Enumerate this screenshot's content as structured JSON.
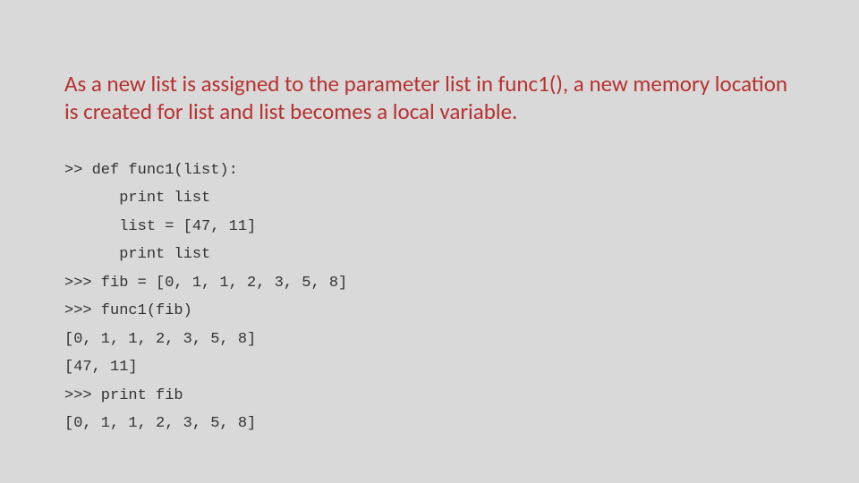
{
  "heading": "As a new list is assigned to the parameter list in func1(), a new memory location is created for list and list becomes a local variable.",
  "code": {
    "l1": ">> def func1(list):",
    "l2": "      print list",
    "l3": "      list = [47, 11]",
    "l4": "      print list",
    "l5": "",
    "l6": ">>> fib = [0, 1, 1, 2, 3, 5, 8]",
    "l7": ">>> func1(fib)",
    "l8": "[0, 1, 1, 2, 3, 5, 8]",
    "l9": "[47, 11]",
    "l10": ">>> print fib",
    "l11": "[0, 1, 1, 2, 3, 5, 8]"
  }
}
